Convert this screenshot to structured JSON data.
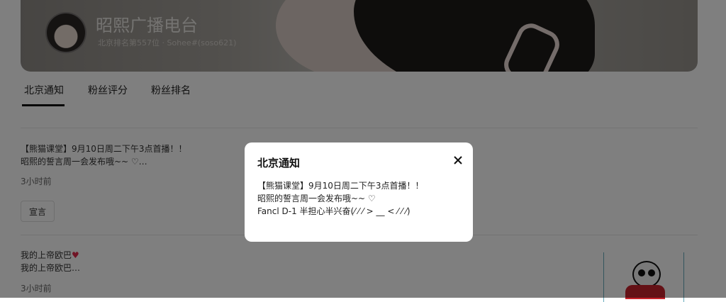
{
  "header": {
    "title": "昭熙广播电台",
    "subtitle": "北京排名第557位 · Sohee#(soso621)"
  },
  "tabs": [
    {
      "label": "北京通知"
    },
    {
      "label": "粉丝评分"
    },
    {
      "label": "粉丝排名"
    }
  ],
  "posts": [
    {
      "line1": "【熊猫课堂】9月10日周二下午3点首播！！",
      "line2": "昭熙的誓言周一会发布哦~~ ♡…",
      "time": "3小时前",
      "tag": "宣言"
    },
    {
      "line1": "我的上帝欧巴",
      "line2": "我的上帝欧巴…",
      "time": "3小时前"
    }
  ],
  "modal": {
    "title": "北京通知",
    "lines": [
      "【熊猫课堂】9月10日周二下午3点首播！！",
      "昭熙的誓言周一会发布哦~~ ♡",
      "Fancl D-1 半担心半兴奋(⁄ ⁄ ⁄ > __ < ⁄ ⁄ ⁄)"
    ]
  },
  "colors": {
    "accent": "#111111",
    "heart": "#e0284a",
    "overlay": "rgba(0,0,0,0.5)"
  },
  "icons": {
    "close": "close-icon",
    "heart": "heart-icon"
  }
}
